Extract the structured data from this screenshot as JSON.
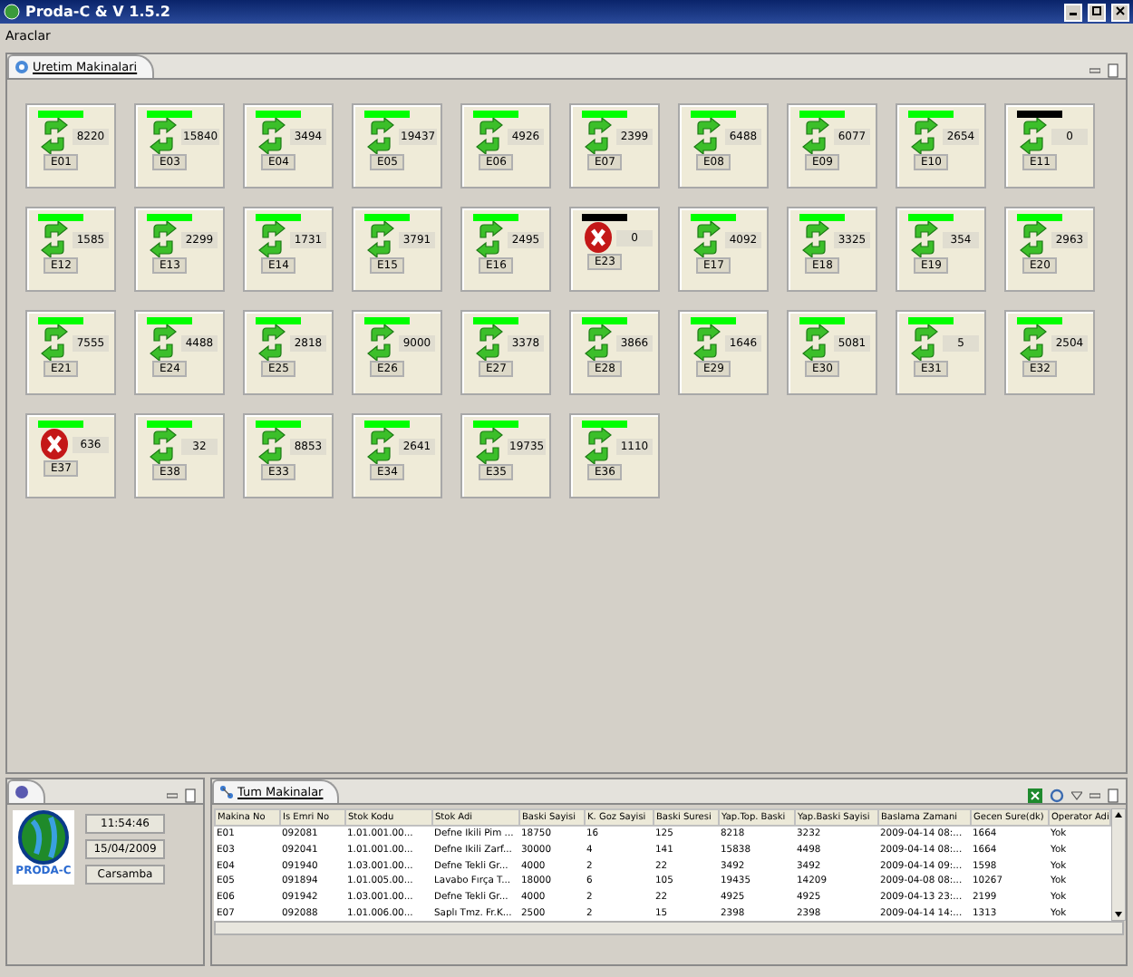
{
  "window": {
    "title": "Proda-C & V 1.5.2"
  },
  "menu": [
    "Araclar"
  ],
  "machines_tab": {
    "label": "Uretim Makinalari",
    "selected": true
  },
  "machines": [
    {
      "code": "E01",
      "count": "8220",
      "kind": "running",
      "color": "#00ff00"
    },
    {
      "code": "E03",
      "count": "15840",
      "kind": "running",
      "color": "#00ff00"
    },
    {
      "code": "E04",
      "count": "3494",
      "kind": "running",
      "color": "#00ff00"
    },
    {
      "code": "E05",
      "count": "19437",
      "kind": "running",
      "color": "#00ff00"
    },
    {
      "code": "E06",
      "count": "4926",
      "kind": "running",
      "color": "#00ff00"
    },
    {
      "code": "E07",
      "count": "2399",
      "kind": "running",
      "color": "#00ff00"
    },
    {
      "code": "E08",
      "count": "6488",
      "kind": "running",
      "color": "#00ff00"
    },
    {
      "code": "E09",
      "count": "6077",
      "kind": "running",
      "color": "#00ff00"
    },
    {
      "code": "E10",
      "count": "2654",
      "kind": "running",
      "color": "#00ff00"
    },
    {
      "code": "E11",
      "count": "0",
      "kind": "running",
      "color": "#000000"
    },
    {
      "code": "E12",
      "count": "1585",
      "kind": "running",
      "color": "#00ff00"
    },
    {
      "code": "E13",
      "count": "2299",
      "kind": "running",
      "color": "#00ff00"
    },
    {
      "code": "E14",
      "count": "1731",
      "kind": "running",
      "color": "#00ff00"
    },
    {
      "code": "E15",
      "count": "3791",
      "kind": "running",
      "color": "#00ff00"
    },
    {
      "code": "E16",
      "count": "2495",
      "kind": "running",
      "color": "#00ff00"
    },
    {
      "code": "E23",
      "count": "0",
      "kind": "error",
      "color": "#000000"
    },
    {
      "code": "E17",
      "count": "4092",
      "kind": "running",
      "color": "#00ff00"
    },
    {
      "code": "E18",
      "count": "3325",
      "kind": "running",
      "color": "#00ff00"
    },
    {
      "code": "E19",
      "count": "354",
      "kind": "running",
      "color": "#00ff00"
    },
    {
      "code": "E20",
      "count": "2963",
      "kind": "running",
      "color": "#00ff00"
    },
    {
      "code": "E21",
      "count": "7555",
      "kind": "running",
      "color": "#00ff00"
    },
    {
      "code": "E24",
      "count": "4488",
      "kind": "running",
      "color": "#00ff00"
    },
    {
      "code": "E25",
      "count": "2818",
      "kind": "running",
      "color": "#00ff00"
    },
    {
      "code": "E26",
      "count": "9000",
      "kind": "running",
      "color": "#00ff00"
    },
    {
      "code": "E27",
      "count": "3378",
      "kind": "running",
      "color": "#00ff00"
    },
    {
      "code": "E28",
      "count": "3866",
      "kind": "running",
      "color": "#00ff00"
    },
    {
      "code": "E29",
      "count": "1646",
      "kind": "running",
      "color": "#00ff00"
    },
    {
      "code": "E30",
      "count": "5081",
      "kind": "running",
      "color": "#00ff00"
    },
    {
      "code": "E31",
      "count": "5",
      "kind": "running",
      "color": "#00ff00"
    },
    {
      "code": "E32",
      "count": "2504",
      "kind": "running",
      "color": "#00ff00"
    },
    {
      "code": "E37",
      "count": "636",
      "kind": "error",
      "color": "#00ff00"
    },
    {
      "code": "E38",
      "count": "32",
      "kind": "running",
      "color": "#00ff00"
    },
    {
      "code": "E33",
      "count": "8853",
      "kind": "running",
      "color": "#00ff00"
    },
    {
      "code": "E34",
      "count": "2641",
      "kind": "running",
      "color": "#00ff00"
    },
    {
      "code": "E35",
      "count": "19735",
      "kind": "running",
      "color": "#00ff00"
    },
    {
      "code": "E36",
      "count": "1110",
      "kind": "running",
      "color": "#00ff00"
    }
  ],
  "info_panel": {
    "logo_text": "PRODA-C",
    "time": "11:54:46",
    "date": "15/04/2009",
    "day": "Carsamba"
  },
  "table_tab": {
    "label": "Tum Makinalar",
    "selected": true
  },
  "table": {
    "columns": [
      "Makina No",
      "Is Emri No",
      "Stok Kodu",
      "Stok Adi",
      "Baski Sayisi",
      "K. Goz Sayisi",
      "Baski Suresi",
      "Yap.Top. Baski",
      "Yap.Baski Sayisi",
      "Baslama Zamani",
      "Gecen Sure(dk)",
      "Operator Adi"
    ],
    "rows": [
      [
        "E01",
        "092081",
        "1.01.001.00...",
        "Defne Ikili Pim ...",
        "18750",
        "16",
        "125",
        "8218",
        "3232",
        "2009-04-14 08:...",
        "1664",
        "Yok"
      ],
      [
        "E03",
        "092041",
        "1.01.001.00...",
        "Defne Ikili Zarf...",
        "30000",
        "4",
        "141",
        "15838",
        "4498",
        "2009-04-14 08:...",
        "1664",
        "Yok"
      ],
      [
        "E04",
        "091940",
        "1.03.001.00...",
        "Defne Tekli Gr...",
        "4000",
        "2",
        "22",
        "3492",
        "3492",
        "2009-04-14 09:...",
        "1598",
        "Yok"
      ],
      [
        "E05",
        "091894",
        "1.01.005.00...",
        "Lavabo Fırça T...",
        "18000",
        "6",
        "105",
        "19435",
        "14209",
        "2009-04-08 08:...",
        "10267",
        "Yok"
      ],
      [
        "E06",
        "091942",
        "1.03.001.00...",
        "Defne Tekli Gr...",
        "4000",
        "2",
        "22",
        "4925",
        "4925",
        "2009-04-13 23:...",
        "2199",
        "Yok"
      ],
      [
        "E07",
        "092088",
        "1.01.006.00...",
        "Saplı Tmz. Fr.K...",
        "2500",
        "2",
        "15",
        "2398",
        "2398",
        "2009-04-14 14:...",
        "1313",
        "Yok"
      ]
    ]
  }
}
